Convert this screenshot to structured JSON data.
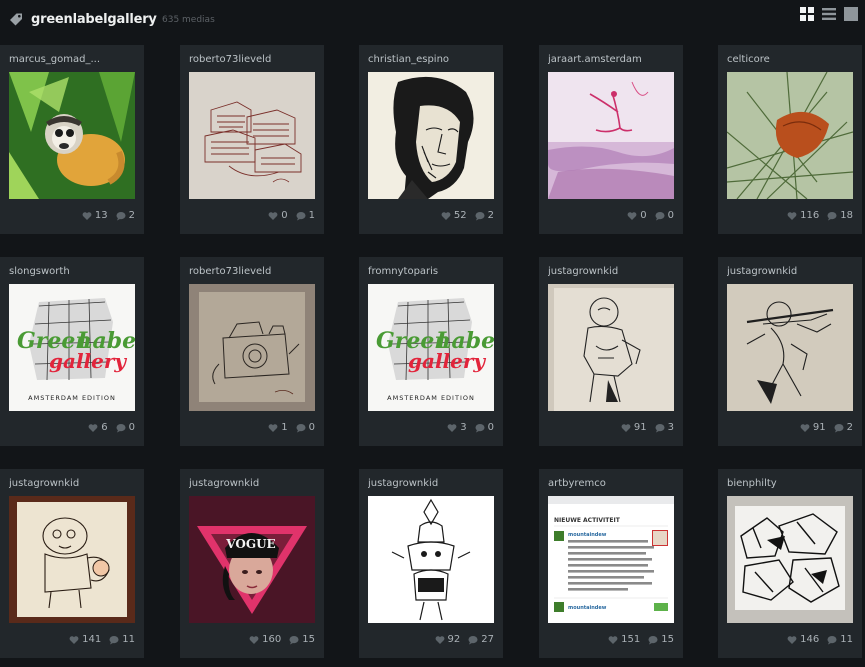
{
  "header": {
    "gallery_name": "greenlabelgallery",
    "media_count": "635 medias",
    "icons": [
      "tag-icon",
      "grid-view-icon",
      "list-view-icon",
      "single-view-icon"
    ]
  },
  "colors": {
    "background": "#121518",
    "tile": "#22272b",
    "text": "#bcc3c7",
    "icon": "#5d656b"
  },
  "tiles": [
    {
      "username": "marcus_gomad_...",
      "likes": "13",
      "comments": "2",
      "image": "squirrel-monkey"
    },
    {
      "username": "roberto73lieveld",
      "likes": "0",
      "comments": "1",
      "image": "pencil-sketch-buildings"
    },
    {
      "username": "christian_espino",
      "likes": "52",
      "comments": "2",
      "image": "ink-portrait"
    },
    {
      "username": "jaraart.amsterdam",
      "likes": "0",
      "comments": "0",
      "image": "pink-watercolor"
    },
    {
      "username": "celticore",
      "likes": "116",
      "comments": "18",
      "image": "leaf-on-pine"
    },
    {
      "username": "slongsworth",
      "likes": "6",
      "comments": "0",
      "image": "green-label-gallery-poster"
    },
    {
      "username": "roberto73lieveld",
      "likes": "1",
      "comments": "0",
      "image": "camera-sketch"
    },
    {
      "username": "fromnytoparis",
      "likes": "3",
      "comments": "0",
      "image": "green-label-gallery-poster"
    },
    {
      "username": "justagrownkid",
      "likes": "91",
      "comments": "3",
      "image": "figure-sketch"
    },
    {
      "username": "justagrownkid",
      "likes": "91",
      "comments": "2",
      "image": "musician-sketch"
    },
    {
      "username": "justagrownkid",
      "likes": "141",
      "comments": "11",
      "image": "cartoon-character"
    },
    {
      "username": "justagrownkid",
      "likes": "160",
      "comments": "15",
      "image": "vogue-triangle"
    },
    {
      "username": "justagrownkid",
      "likes": "92",
      "comments": "27",
      "image": "tribal-totem"
    },
    {
      "username": "artbyremco",
      "likes": "151",
      "comments": "15",
      "image": "activity-screenshot"
    },
    {
      "username": "bienphilty",
      "likes": "146",
      "comments": "11",
      "image": "graffiti-sketch"
    }
  ],
  "poster_text": {
    "green": "Green",
    "label": "Label",
    "gallery": "gallery",
    "edition": "AMSTERDAM EDITION"
  },
  "activity_text": {
    "title": "NIEUWE ACTIVITEIT",
    "username": "mountaindew"
  },
  "vogue_text": "VOGUE"
}
